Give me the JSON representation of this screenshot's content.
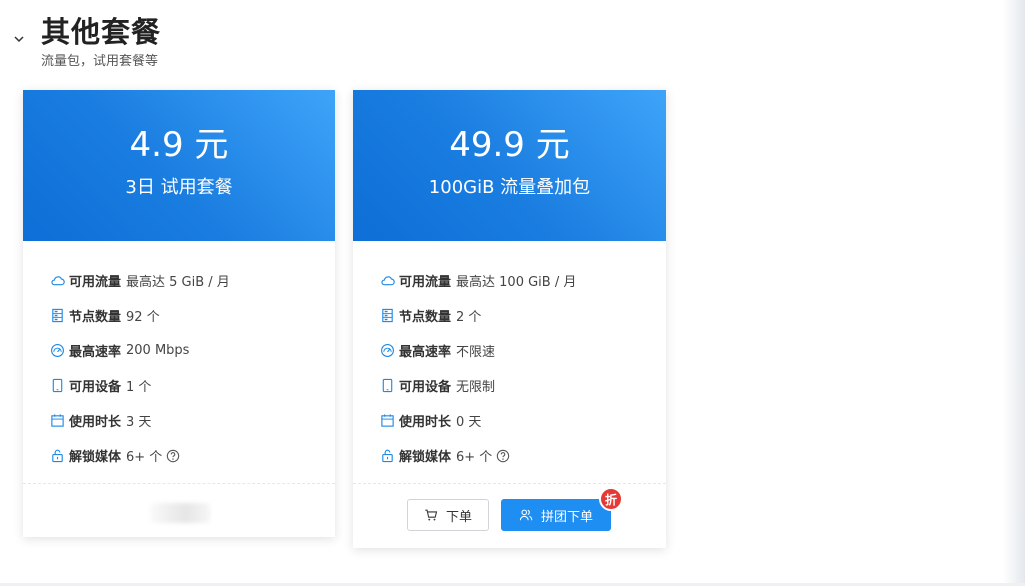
{
  "section": {
    "title": "其他套餐",
    "subtitle": "流量包，试用套餐等"
  },
  "colors": {
    "accent": "#1e8ef2",
    "badge": "#e53935",
    "icon": "#1e88e5"
  },
  "plans": [
    {
      "price": "4.9 元",
      "name": "3日 试用套餐",
      "features": [
        {
          "icon": "cloud-icon",
          "label": "可用流量",
          "value": "最高达 5 GiB / 月"
        },
        {
          "icon": "server-icon",
          "label": "节点数量",
          "value": "92 个"
        },
        {
          "icon": "speedometer-icon",
          "label": "最高速率",
          "value": "200 Mbps"
        },
        {
          "icon": "tablet-icon",
          "label": "可用设备",
          "value": "1 个"
        },
        {
          "icon": "calendar-icon",
          "label": "使用时长",
          "value": "3 天"
        },
        {
          "icon": "unlock-icon",
          "label": "解锁媒体",
          "value": "6+ 个"
        }
      ]
    },
    {
      "price": "49.9 元",
      "name": "100GiB 流量叠加包",
      "features": [
        {
          "icon": "cloud-icon",
          "label": "可用流量",
          "value": "最高达 100 GiB / 月"
        },
        {
          "icon": "server-icon",
          "label": "节点数量",
          "value": "2 个"
        },
        {
          "icon": "speedometer-icon",
          "label": "最高速率",
          "value": "不限速"
        },
        {
          "icon": "tablet-icon",
          "label": "可用设备",
          "value": "无限制"
        },
        {
          "icon": "calendar-icon",
          "label": "使用时长",
          "value": "0 天"
        },
        {
          "icon": "unlock-icon",
          "label": "解锁媒体",
          "value": "6+ 个"
        }
      ],
      "actions": {
        "order_label": "下单",
        "group_order_label": "拼团下单",
        "discount_badge": "折"
      }
    }
  ]
}
